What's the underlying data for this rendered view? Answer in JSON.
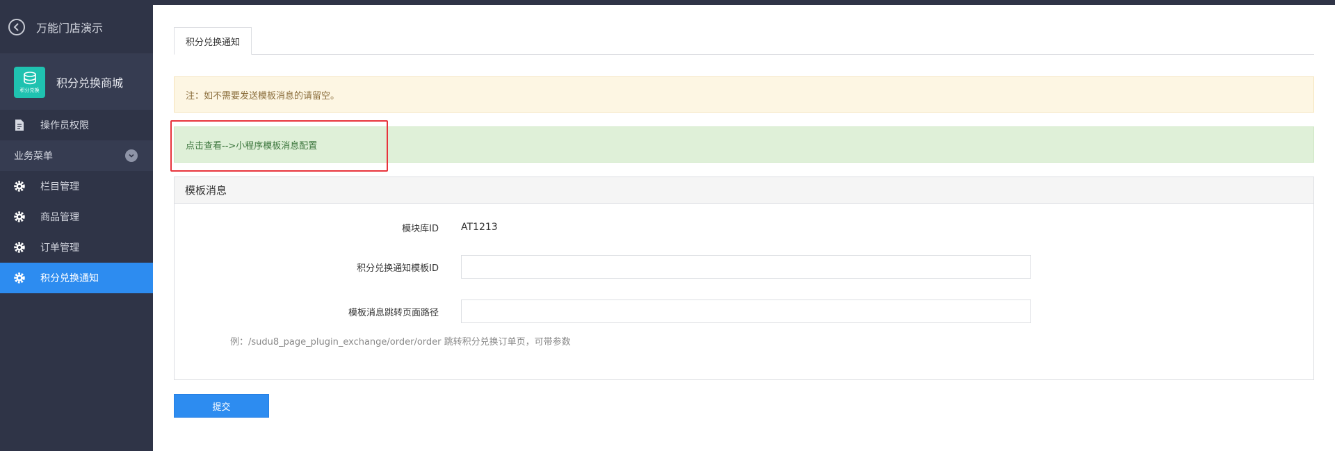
{
  "sidebar": {
    "back_title": "万能门店演示",
    "app_name": "积分兑换商城",
    "app_logo_text": "积分兑换",
    "operator_item": "操作员权限",
    "group_label": "业务菜单",
    "menu_items": [
      {
        "label": "栏目管理"
      },
      {
        "label": "商品管理"
      },
      {
        "label": "订单管理"
      },
      {
        "label": "积分兑换通知"
      }
    ]
  },
  "main": {
    "tab_label": "积分兑换通知",
    "notice_warning": "注：如不需要发送模板消息的请留空。",
    "notice_link": "点击查看-->小程序模板消息配置",
    "panel_title": "模板消息",
    "fields": {
      "library_id_label": "模块库ID",
      "library_id_value": "AT1213",
      "template_id_label": "积分兑换通知模板ID",
      "template_id_value": "",
      "jump_path_label": "模板消息跳转页面路径",
      "jump_path_value": ""
    },
    "hint": "例：/sudu8_page_plugin_exchange/order/order 跳转积分兑换订单页，可带参数",
    "submit_label": "提交"
  },
  "colors": {
    "sidebar_bg": "#2f3447",
    "active_item": "#2d8cf0",
    "app_logo": "#1fc2b0",
    "warning_bg": "#fdf6e3",
    "success_bg": "#dff0d8",
    "highlight_border": "#e8333b",
    "primary_button": "#2d8cf0"
  }
}
